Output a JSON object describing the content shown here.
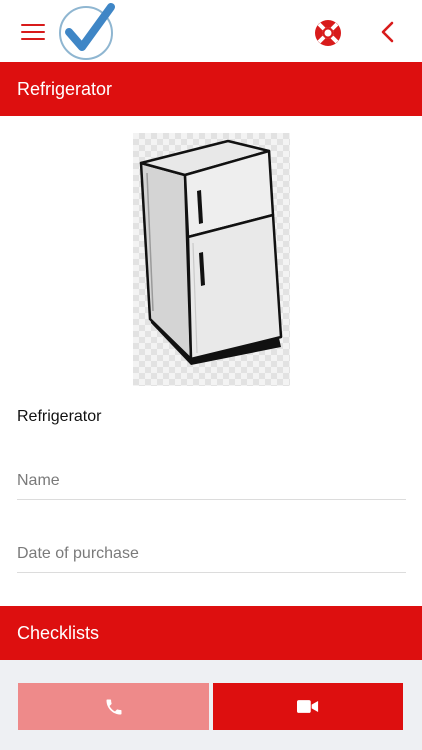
{
  "header": {
    "menu_icon": "hamburger-menu-icon",
    "logo_icon": "checkmark-logo-icon",
    "help_icon": "lifebuoy-icon",
    "back_icon": "chevron-left-icon"
  },
  "section": {
    "title": "Refrigerator"
  },
  "appliance": {
    "name": "Refrigerator",
    "image": "refrigerator-illustration"
  },
  "form": {
    "name_placeholder": "Name",
    "name_value": "",
    "date_placeholder": "Date of purchase",
    "date_value": ""
  },
  "checklists": {
    "title": "Checklists"
  },
  "actions": {
    "call_icon": "phone-icon",
    "video_icon": "video-camera-icon"
  },
  "colors": {
    "accent": "#dd0f0f",
    "accent_light": "#ee8a8a",
    "bottom_background": "#eef0f3"
  }
}
